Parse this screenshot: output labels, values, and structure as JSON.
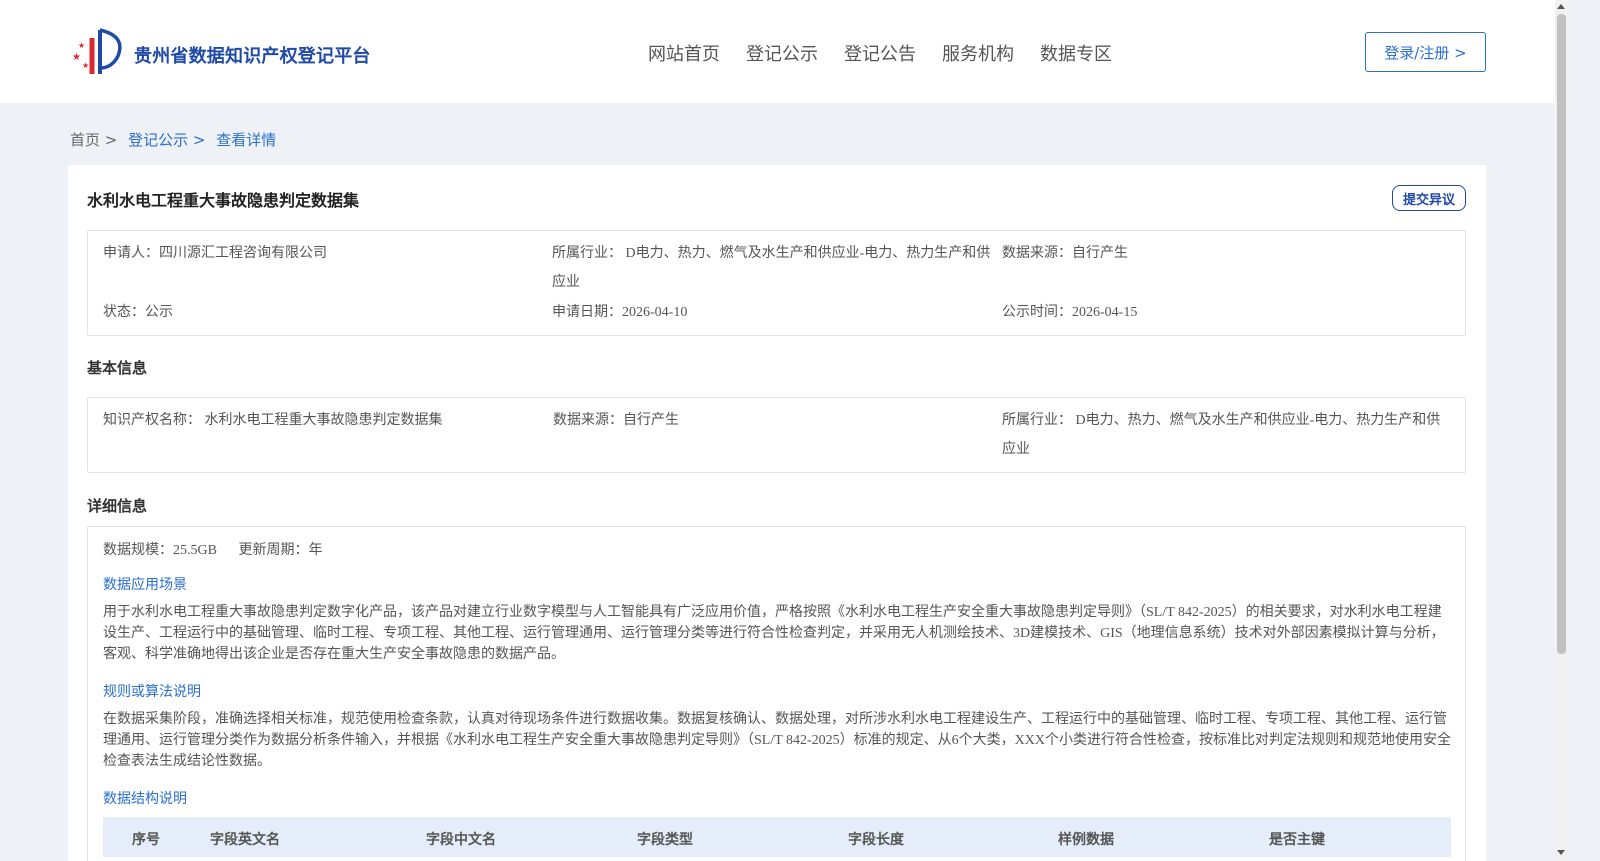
{
  "header": {
    "logo_text": "贵州省数据知识产权登记平台",
    "nav": [
      "网站首页",
      "登记公示",
      "登记公告",
      "服务机构",
      "数据专区"
    ],
    "login_label": "登录/注册 >"
  },
  "breadcrumb": {
    "home": "首页 >",
    "section": "登记公示 >",
    "current": "查看详情"
  },
  "detail": {
    "title": "水利水电工程重大事故隐患判定数据集",
    "objection_label": "提交异议",
    "summary": {
      "applicant": "申请人：四川源汇工程咨询有限公司",
      "industry": "所属行业： D电力、热力、燃气及水生产和供应业-电力、热力生产和供应业",
      "data_source": "数据来源：自行产生",
      "status": "状态：公示",
      "apply_date": "申请日期：2026-04-10",
      "publish_date": "公示时间：2026-04-15"
    },
    "basic": {
      "title": "基本信息",
      "ip_name": "知识产权名称： 水利水电工程重大事故隐患判定数据集",
      "data_source": "数据来源：自行产生",
      "industry": "所属行业： D电力、热力、燃气及水生产和供应业-电力、热力生产和供应业"
    },
    "detail_info": {
      "title": "详细信息",
      "data_scale": "数据规模：25.5GB",
      "update_cycle": "更新周期：年",
      "scenario_title": "数据应用场景",
      "scenario_text": "用于水利水电工程重大事故隐患判定数字化产品，该产品对建立行业数字模型与人工智能具有广泛应用价值，严格按照《水利水电工程生产安全重大事故隐患判定导则》（SL/T 842-2025）的相关要求，对水利水电工程建设生产、工程运行中的基础管理、临时工程、专项工程、其他工程、运行管理通用、运行管理分类等进行符合性检查判定，并采用无人机测绘技术、3D建模技术、GIS（地理信息系统）技术对外部因素模拟计算与分析，客观、科学准确地得出该企业是否存在重大生产安全事故隐患的数据产品。",
      "algorithm_title": "规则或算法说明",
      "algorithm_text": "在数据采集阶段，准确选择相关标准，规范使用检查条款，认真对待现场条件进行数据收集。数据复核确认、数据处理，对所涉水利水电工程建设生产、工程运行中的基础管理、临时工程、专项工程、其他工程、运行管理通用、运行管理分类作为数据分析条件输入，并根据《水利水电工程生产安全重大事故隐患判定导则》（SL/T 842-2025）标准的规定、从6个大类，XXX个小类进行符合性检查，按标准比对判定法规则和规范地使用安全检查表法生成结论性数据。",
      "structure_title": "数据结构说明",
      "table_headers": [
        "序号",
        "字段英文名",
        "字段中文名",
        "字段类型",
        "字段长度",
        "样例数据",
        "是否主键"
      ]
    }
  },
  "colors": {
    "brand": "#1f4aa8",
    "link": "#2a6fcf",
    "table_head_bg": "#e4edf9"
  }
}
